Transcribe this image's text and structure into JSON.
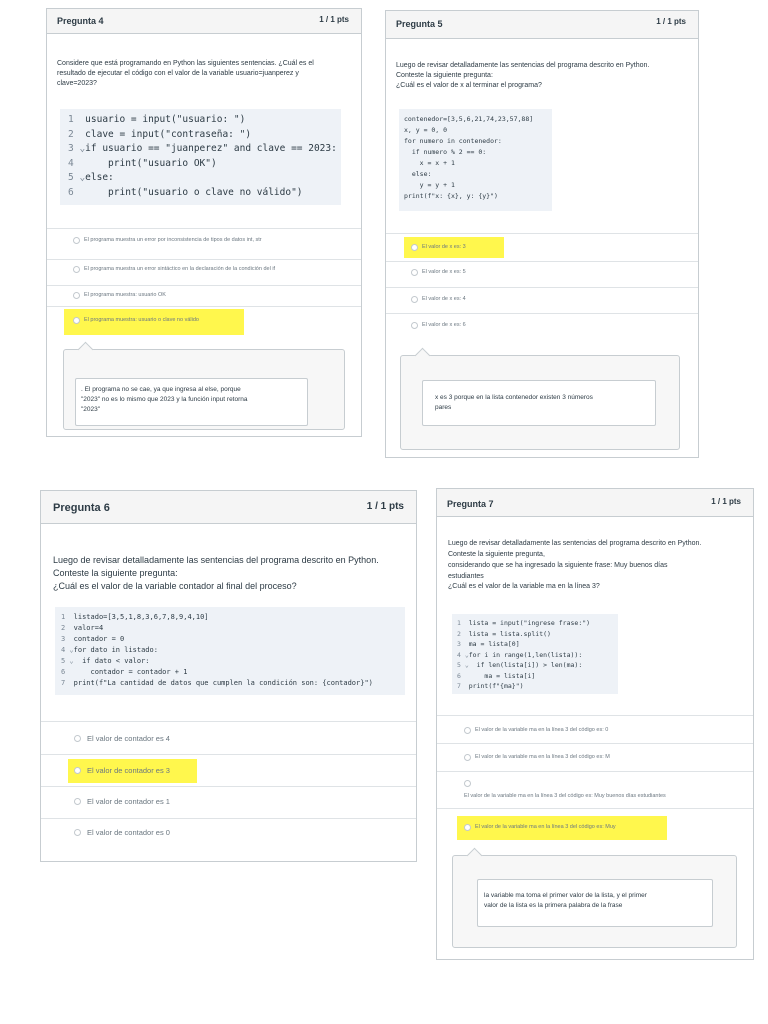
{
  "colors": {
    "highlight": "#fff74d",
    "header_bg": "#f5f5f5",
    "code_bg": "#eef2f7",
    "border": "#c7cdd1"
  },
  "q4": {
    "title": "Pregunta 4",
    "points": "1 / 1 pts",
    "question_lines": [
      "Considere que está programando en Python las siguientes sentencias. ¿Cuál es el",
      "resultado de ejecutar el código con el valor de la variable usuario=juanperez y",
      "clave=2023?"
    ],
    "code_lines": [
      "usuario = input(\"usuario: \")",
      "clave = input(\"contraseña: \")",
      "if usuario == \"juanperez\" and clave == 2023:",
      "    print(\"usuario OK\")",
      "else:",
      "    print(\"usuario o clave no válido\")"
    ],
    "answers": [
      "El programa muestra un error por inconsistencia de tipos de datos int, str",
      "El programa muestra un error sintáctico en la declaración de la condición del if",
      "El programa muestra: usuario OK",
      "El programa muestra: usuario o clave no válido"
    ],
    "comment_lines": [
      ". El programa no se cae, ya que ingresa al else, porque",
      "\"2023\" no es lo mismo que 2023 y la función input retorna",
      "\"2023\""
    ]
  },
  "q5": {
    "title": "Pregunta 5",
    "points": "1 / 1 pts",
    "question_lines": [
      "Luego de revisar detalladamente las sentencias del programa descrito en Python.",
      "Conteste la siguiente pregunta:",
      "¿Cuál es el valor de x al terminar el programa?"
    ],
    "code_lines": [
      "contenedor=[3,5,6,21,74,23,57,88]",
      "x, y = 0, 0",
      "for numero in contenedor:",
      "  if numero % 2 == 0:",
      "    x = x + 1",
      "  else:",
      "    y = y + 1",
      "print(f\"x: {x}, y: {y}\")"
    ],
    "answers": [
      "El valor de x es: 3",
      "El valor de x es: 5",
      "El valor de x es: 4",
      "El valor de x es: 6"
    ],
    "comment_lines": [
      "x es 3 porque en la lista contenedor existen 3 números",
      "pares"
    ]
  },
  "q6": {
    "title": "Pregunta 6",
    "points": "1 / 1 pts",
    "question_lines": [
      "Luego de revisar detalladamente las sentencias del programa descrito en Python.",
      "Conteste la siguiente pregunta:",
      "¿Cuál es el valor de la variable contador al final del proceso?"
    ],
    "code_lines": [
      "listado=[3,5,1,8,3,6,7,8,9,4,10]",
      "valor=4",
      "contador = 0",
      "for dato in listado:",
      "  if dato < valor:",
      "    contador = contador + 1",
      "print(f\"La cantidad de datos que cumplen la condición son: {contador}\")"
    ],
    "answers": [
      "El valor de contador es 4",
      "El valor de contador es 3",
      "El valor de contador es 1",
      "El valor de contador es 0"
    ]
  },
  "q7": {
    "title": "Pregunta 7",
    "points": "1 / 1 pts",
    "question_lines": [
      "Luego de revisar detalladamente las sentencias del programa descrito en Python.",
      "Conteste la siguiente pregunta,",
      "considerando que se ha ingresado la siguiente frase: Muy buenos días",
      "estudiantes",
      "¿Cuál es el valor de la variable ma en la línea 3?"
    ],
    "code_lines": [
      "lista = input(\"ingrese frase:\")",
      "lista = lista.split()",
      "ma = lista[0]",
      "for i in range(1,len(lista)):",
      "  if len(lista[i]) > len(ma):",
      "    ma = lista[i]",
      "print(f\"{ma}\")"
    ],
    "answers": [
      "El valor de la variable ma en la línea 3 del código es: 0",
      "El valor de la variable ma en la línea 3 del código es: M",
      "El valor de la variable ma en la línea 3 del código es: Muy buenos días estudiantes",
      "El valor de la variable ma en la línea 3 del código es: Muy"
    ],
    "comment_lines": [
      "la variable ma toma el primer valor de la lista, y el primer",
      "valor de la lista es la primera palabra de la frase"
    ]
  }
}
